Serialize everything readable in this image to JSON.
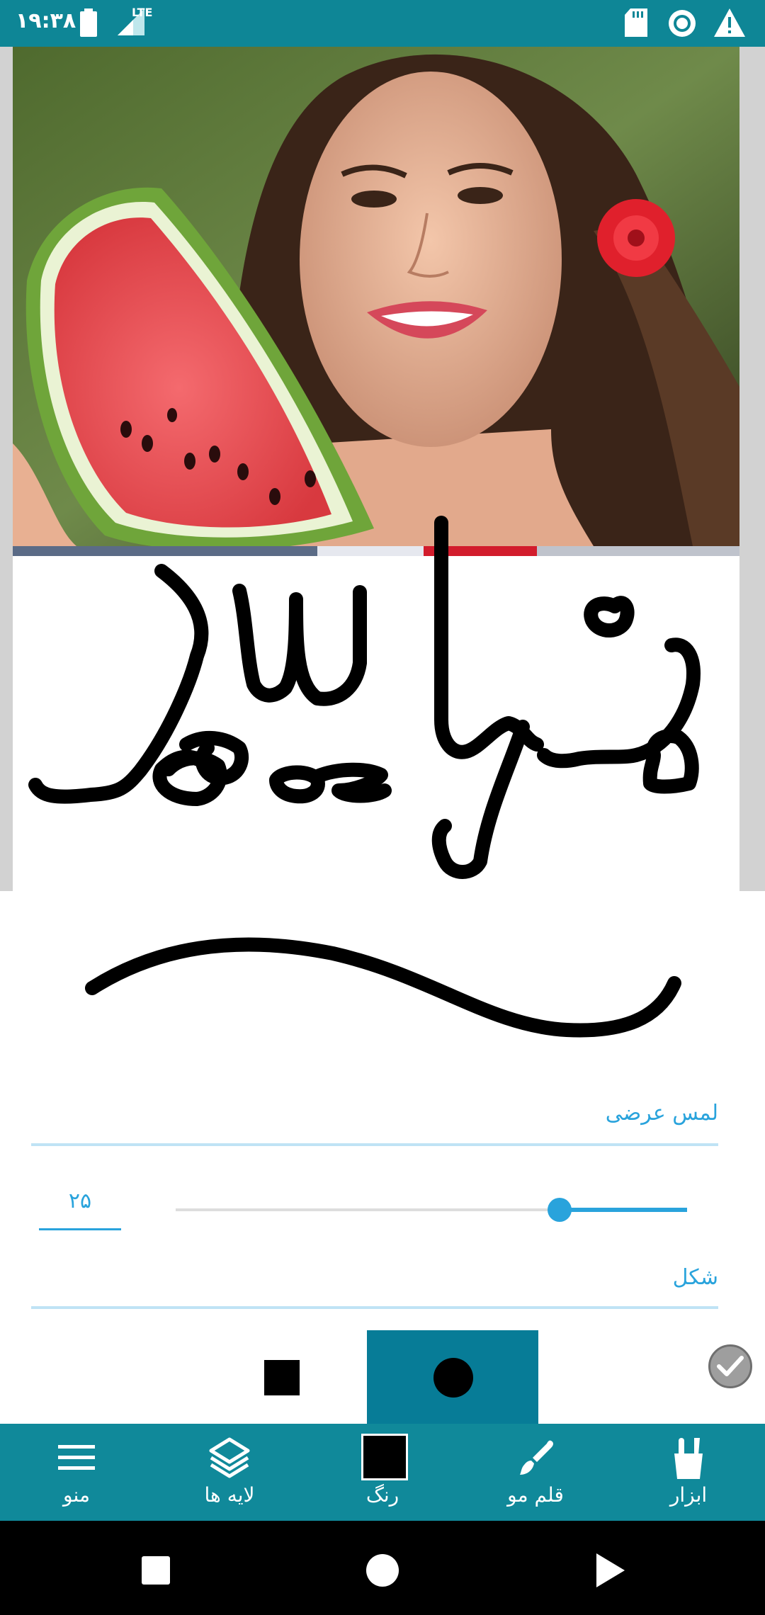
{
  "status_bar": {
    "time": "۱۹:۳۸",
    "network_label": "LTE",
    "icons": [
      "battery-icon",
      "signal-icon",
      "sd-card-icon",
      "sync-circle-icon",
      "warning-icon"
    ]
  },
  "canvas": {
    "photo_description_icon": "photo-layer"
  },
  "panel": {
    "stroke_section_label": "لمس عرضی",
    "size_value": "۲۵",
    "size_level_fraction": 0.75,
    "shape_section_label": "شکل",
    "shapes": [
      "square",
      "circle"
    ],
    "selected_shape": "circle"
  },
  "toolbar": {
    "items": [
      {
        "label": "منو",
        "icon": "menu-icon"
      },
      {
        "label": "لایه ها",
        "icon": "layers-icon"
      },
      {
        "label": "رنگ",
        "icon": "color-swatch"
      },
      {
        "label": "قلم مو",
        "icon": "brush-icon"
      },
      {
        "label": "ابزار",
        "icon": "tools-icon"
      }
    ]
  },
  "colors": {
    "primary": "#10899a",
    "accent": "#29a3dc",
    "selected_shape_bg": "#077c97",
    "brush_color": "#000000"
  }
}
